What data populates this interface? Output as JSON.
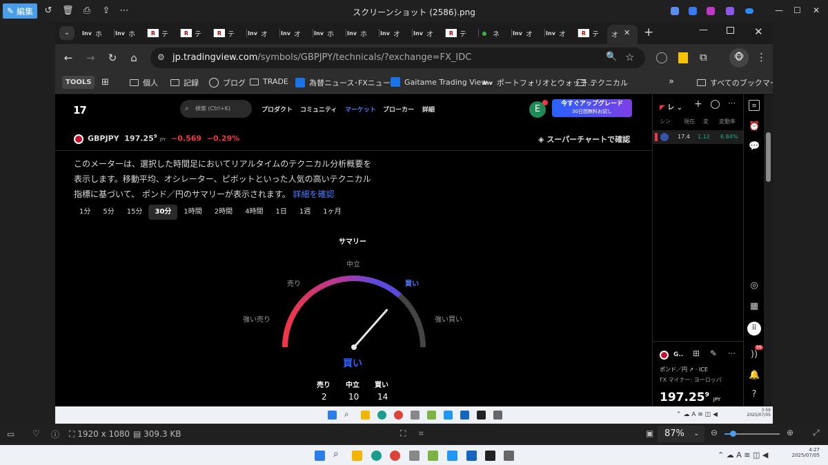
{
  "viewer": {
    "edit_label": "編集",
    "title": "スクリーンショット (2586).png",
    "resolution": "1920 x 1080",
    "filesize": "309.3 KB",
    "zoom": "87%"
  },
  "browser": {
    "tabs": [
      {
        "fav": "Inv",
        "text": "ホ"
      },
      {
        "fav": "Inv",
        "text": "ホ"
      },
      {
        "fav": "R",
        "text": "テ"
      },
      {
        "fav": "R",
        "text": "テ"
      },
      {
        "fav": "R",
        "text": "テ"
      },
      {
        "fav": "Inv",
        "text": "オ"
      },
      {
        "fav": "Inv",
        "text": "オ"
      },
      {
        "fav": "Inv",
        "text": "ホ"
      },
      {
        "fav": "Inv",
        "text": "ホ"
      },
      {
        "fav": "Inv",
        "text": "オ"
      },
      {
        "fav": "Inv",
        "text": "オ"
      },
      {
        "fav": "R",
        "text": "テ"
      },
      {
        "fav": "●",
        "text": "ネ"
      },
      {
        "fav": "Inv",
        "text": "オ"
      },
      {
        "fav": "Inv",
        "text": "オ"
      },
      {
        "fav": "R",
        "text": "テ"
      }
    ],
    "active_tab_text": "オ",
    "url_domain": "jp.tradingview.com",
    "url_path": "/symbols/GBPJPY/technicals/?exchange=FX_IDC",
    "bookmarks": {
      "tools": "TOOLS",
      "items": [
        "個人",
        "記録",
        "ブログ",
        "TRADE",
        "為替ニュース･FXニュー...",
        "Gaitame Trading View",
        "ポートフォリオとウォッチ...",
        "テクニカル"
      ],
      "all": "すべてのブックマーク"
    }
  },
  "tv": {
    "logo": "17",
    "search_placeholder": "検索 (Ctrl+K)",
    "nav": [
      "プロダクト",
      "コミュニティ",
      "マーケット",
      "ブローカー",
      "詳細"
    ],
    "avatar": "E",
    "upgrade_title": "今すぐアップグレード",
    "upgrade_sub": "30日間無料お試し",
    "symbol": "GBPJPY",
    "price": "197.25",
    "price_sup": "9",
    "currency": "JPY",
    "change": "−0.569",
    "change_pct": "−0.29%",
    "super_chart": "スーパーチャートで確認",
    "description": "このメーターは、選択した時間足においてリアルタイムのテクニカル分析概要を表示します。移動平均、オシレーター、ピボットといった人気の高いテクニカル指標に基づいて、 ポンド／円のサマリーが表示されます。",
    "more_link": "詳細を確認",
    "timeframes": [
      "1分",
      "5分",
      "15分",
      "30分",
      "1時間",
      "2時間",
      "4時間",
      "1日",
      "1週",
      "1ヶ月"
    ],
    "active_timeframe": "30分",
    "gauge": {
      "title": "サマリー",
      "labels": {
        "neutral": "中立",
        "sell": "売り",
        "buy": "買い",
        "strong_sell": "強い売り",
        "strong_buy": "強い買い"
      },
      "needle_value": 0.73,
      "verdict": "買い"
    },
    "counts": [
      {
        "label": "売り",
        "value": "2"
      },
      {
        "label": "中立",
        "value": "10"
      },
      {
        "label": "買い",
        "value": "14"
      }
    ]
  },
  "watchlist": {
    "title": "レ",
    "columns": [
      "シン",
      "現在",
      "変",
      "変動率"
    ],
    "row": {
      "price": "17.4",
      "change": "1.12",
      "pct": "6.84%"
    },
    "detail_symbol": "G..",
    "detail_name": "ポンド／円",
    "detail_exchange": "ICE",
    "detail_sub": "FX マイナー: ヨーロッパ",
    "detail_price": "197.25",
    "detail_price_sup": "9",
    "detail_currency": "JPY",
    "badge": "99"
  },
  "taskbar": {
    "inner_time": "3:59",
    "inner_date": "2025/07/05",
    "time": "4:27",
    "date": "2025/07/05"
  },
  "colors": {
    "accent": "#2962ff",
    "negative": "#f23645",
    "positive": "#22ab94"
  }
}
